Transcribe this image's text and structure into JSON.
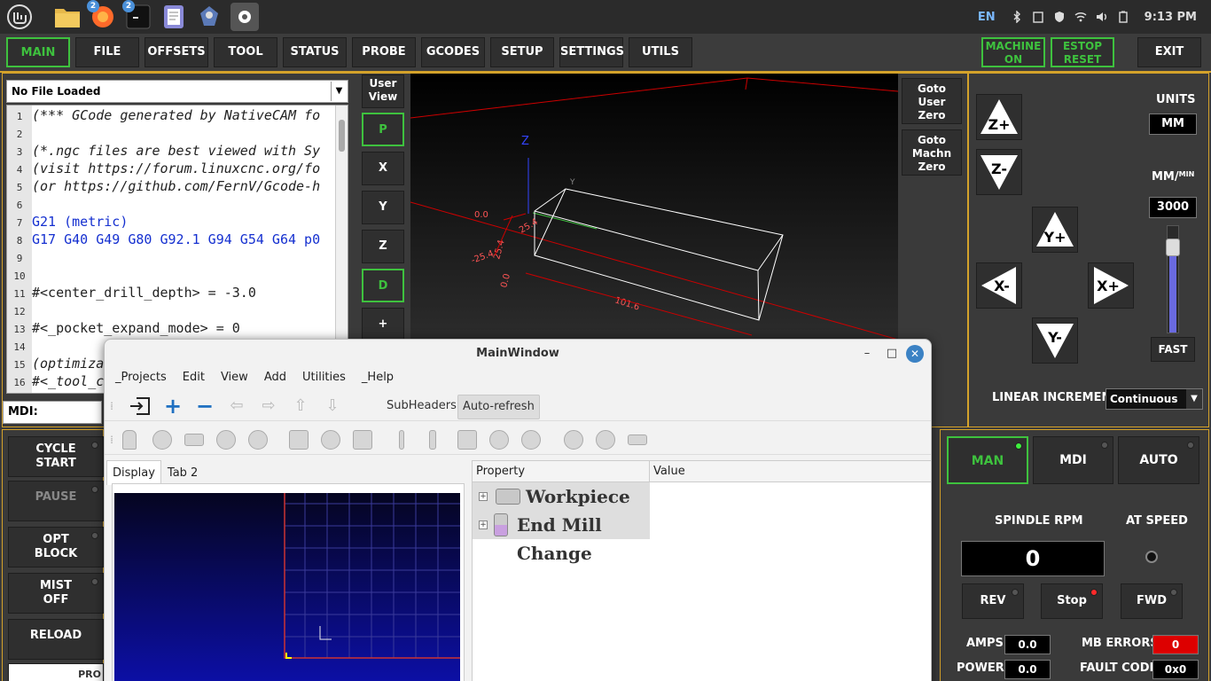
{
  "taskbar": {
    "badges": [
      "2",
      "2"
    ],
    "lang": "EN",
    "time": "9:13 PM"
  },
  "topbar": {
    "tabs": [
      "MAIN",
      "FILE",
      "OFFSETS",
      "TOOL",
      "STATUS",
      "PROBE",
      "GCODES",
      "SETUP",
      "SETTINGS",
      "UTILS"
    ],
    "machine_on": [
      "MACHINE",
      "ON"
    ],
    "estop_reset": [
      "ESTOP",
      "RESET"
    ],
    "exit": "EXIT"
  },
  "file": {
    "header": "No File Loaded",
    "lines": [
      {
        "n": "1",
        "t": "(*** GCode generated by NativeCAM fo",
        "c": ""
      },
      {
        "n": "2",
        "t": "",
        "c": ""
      },
      {
        "n": "3",
        "t": "(*.ngc files are best viewed with Sy",
        "c": ""
      },
      {
        "n": "4",
        "t": "(visit https://forum.linuxcnc.org/fo",
        "c": ""
      },
      {
        "n": "5",
        "t": "(or https://github.com/FernV/Gcode-h",
        "c": ""
      },
      {
        "n": "6",
        "t": "",
        "c": ""
      },
      {
        "n": "7",
        "t": "G21  (metric)",
        "c": "blue"
      },
      {
        "n": "8",
        "t": "G17 G40 G49 G80 G92.1 G94 G54 G64 p0",
        "c": "blue"
      },
      {
        "n": "9",
        "t": "",
        "c": ""
      },
      {
        "n": "10",
        "t": "",
        "c": ""
      },
      {
        "n": "11",
        "t": "#<center_drill_depth>       = -3.0",
        "c": "plain"
      },
      {
        "n": "12",
        "t": "",
        "c": ""
      },
      {
        "n": "13",
        "t": "#<_pocket_expand_mode>      = 0",
        "c": "plain"
      },
      {
        "n": "14",
        "t": "",
        "c": ""
      },
      {
        "n": "15",
        "t": "(optimiza",
        "c": ""
      },
      {
        "n": "16",
        "t": "#<_tool_c",
        "c": ""
      }
    ],
    "mdi_label": "MDI:"
  },
  "view": {
    "user_view": [
      "User",
      "View"
    ],
    "buttons": [
      "P",
      "X",
      "Y",
      "Z",
      "D",
      "+"
    ],
    "goto_user": [
      "Goto",
      "User",
      "Zero"
    ],
    "goto_machine": [
      "Goto",
      "Machn",
      "Zero"
    ],
    "axis_z": "Z",
    "axis_y": "Y",
    "dims": {
      "d1": "0.0",
      "d2": "25.4",
      "d3": "-25.4",
      "d4": "0.0",
      "d5": "101.6",
      "d6": "25.4"
    }
  },
  "jog": {
    "units_label": "UNITS",
    "units_value": "MM",
    "feed_label": "MM/",
    "feed_sup": "MIN",
    "feed_value": "3000",
    "fast": "FAST",
    "buttons": {
      "zp": "Z+",
      "zm": "Z-",
      "yp": "Y+",
      "xm": "X-",
      "xp": "X+",
      "ym": "Y-"
    },
    "linear_label": "LINEAR INCREMENT",
    "linear_value": "Continuous",
    "feed_slider_fraction": 0.85
  },
  "left_buttons": [
    {
      "label": [
        "CYCLE",
        "START"
      ]
    },
    {
      "label": [
        "PAUSE"
      ]
    },
    {
      "label": [
        "OPT",
        "BLOCK"
      ]
    },
    {
      "label": [
        "MIST",
        "OFF"
      ]
    },
    {
      "label": [
        "RELOAD"
      ]
    },
    {
      "label": [
        "PRO"
      ]
    }
  ],
  "modes": {
    "man": "MAN",
    "mdi": "MDI",
    "auto": "AUTO"
  },
  "spindle": {
    "rpm_label": "SPINDLE RPM",
    "rpm_value": "0",
    "at_speed": "AT SPEED",
    "rev": "REV",
    "stop": "Stop",
    "fwd": "FWD",
    "amps_label": "AMPS",
    "amps_value": "0.0",
    "power_label": "POWER",
    "power_value": "0.0",
    "mb_errors_label": "MB ERRORS",
    "mb_errors_value": "0",
    "fault_label": "FAULT CODE",
    "fault_value": "0x0"
  },
  "mainwindow": {
    "title": "MainWindow",
    "menu": [
      "_Projects",
      "Edit",
      "View",
      "Add",
      "Utilities",
      "_Help"
    ],
    "subheaders": "SubHeaders",
    "autorefresh": "Auto-refresh",
    "tabs": [
      "Display",
      "Tab 2"
    ],
    "prop_header": "Property",
    "value_header": "Value",
    "rows": [
      "Workpiece",
      "End Mill Change"
    ]
  }
}
